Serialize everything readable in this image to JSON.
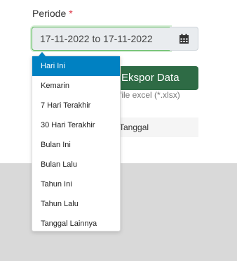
{
  "form": {
    "periode_label": "Periode",
    "required_mark": "*",
    "date_range_value": "17-11-2022 to 17-11-2022"
  },
  "export": {
    "button_label": "Ekspor Data",
    "hint": "file excel (*.xlsx)",
    "third_row_label": "Tanggal"
  },
  "dropdown": {
    "items": [
      {
        "label": "Hari Ini",
        "active": true
      },
      {
        "label": "Kemarin"
      },
      {
        "label": "7 Hari Terakhir"
      },
      {
        "label": "30 Hari Terakhir"
      },
      {
        "label": "Bulan Ini"
      },
      {
        "label": "Bulan Lalu"
      },
      {
        "label": "Tahun Ini"
      },
      {
        "label": "Tahun Lalu"
      },
      {
        "label": "Tanggal Lainnya"
      }
    ]
  },
  "colors": {
    "accent_green": "#2e6b45",
    "active_item_bg": "#0081c2",
    "required": "#dc3545"
  },
  "icons": {
    "calendar": "calendar-icon"
  }
}
